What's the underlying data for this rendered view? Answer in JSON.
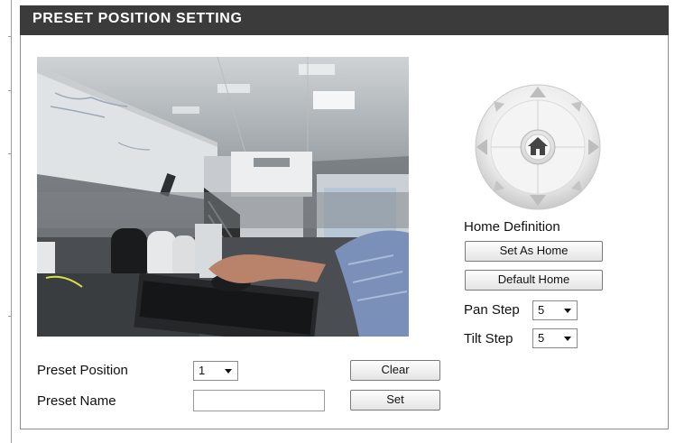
{
  "section": {
    "title": "PRESET POSITION SETTING"
  },
  "camera_view": {
    "label": "live camera view"
  },
  "ptz": {
    "home_definition_label": "Home Definition",
    "set_as_home_label": "Set As Home",
    "default_home_label": "Default Home",
    "pan_step_label": "Pan Step",
    "pan_step_value": "5",
    "tilt_step_label": "Tilt Step",
    "tilt_step_value": "5",
    "icons": [
      "arrow-up-icon",
      "arrow-down-icon",
      "arrow-left-icon",
      "arrow-right-icon",
      "arrow-up-left-icon",
      "arrow-up-right-icon",
      "arrow-down-left-icon",
      "arrow-down-right-icon",
      "home-icon"
    ]
  },
  "preset": {
    "position_label": "Preset Position",
    "position_value": "1",
    "name_label": "Preset Name",
    "name_value": "",
    "clear_label": "Clear",
    "set_label": "Set"
  },
  "colors": {
    "header_bg": "#3b3b3b",
    "header_text": "#ffffff",
    "border": "#8c8c8c"
  }
}
